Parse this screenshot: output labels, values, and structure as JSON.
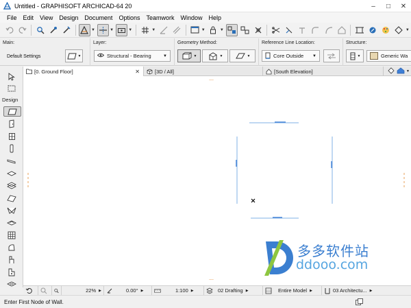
{
  "window": {
    "title": "Untitled - GRAPHISOFT ARCHICAD-64 20",
    "minimize": "–",
    "maximize": "□",
    "close": "✕"
  },
  "menu": [
    "File",
    "Edit",
    "View",
    "Design",
    "Document",
    "Options",
    "Teamwork",
    "Window",
    "Help"
  ],
  "infobox": {
    "main_label": "Main:",
    "main_value": "Default Settings",
    "layer_label": "Layer:",
    "layer_value": "Structural - Bearing",
    "geometry_label": "Geometry Method:",
    "refline_label": "Reference Line Location:",
    "refline_value": "Core Outside",
    "structure_label": "Structure:",
    "structure_value": "Generic Wa"
  },
  "tabs": {
    "floor": "[0. Ground Floor]",
    "floor_close": "✕",
    "view3d": "[3D / All]",
    "elevation": "[South Elevation]"
  },
  "toolbox": {
    "section_label": "Design"
  },
  "statusbar": {
    "zoom": "22%",
    "angle": "0.00°",
    "scale": "1:100",
    "layer_combo": "02 Drafting",
    "model_view": "Entire Model",
    "renovation": "03 Architectu..."
  },
  "prompt": "Enter First Node of Wall.",
  "watermark": {
    "cn": "多多软件站",
    "en": "ddooo.com"
  },
  "colors": {
    "accent": "#3f7fd6",
    "wall_line": "#7fb0e6",
    "edge_tick": "#e9a05a"
  }
}
